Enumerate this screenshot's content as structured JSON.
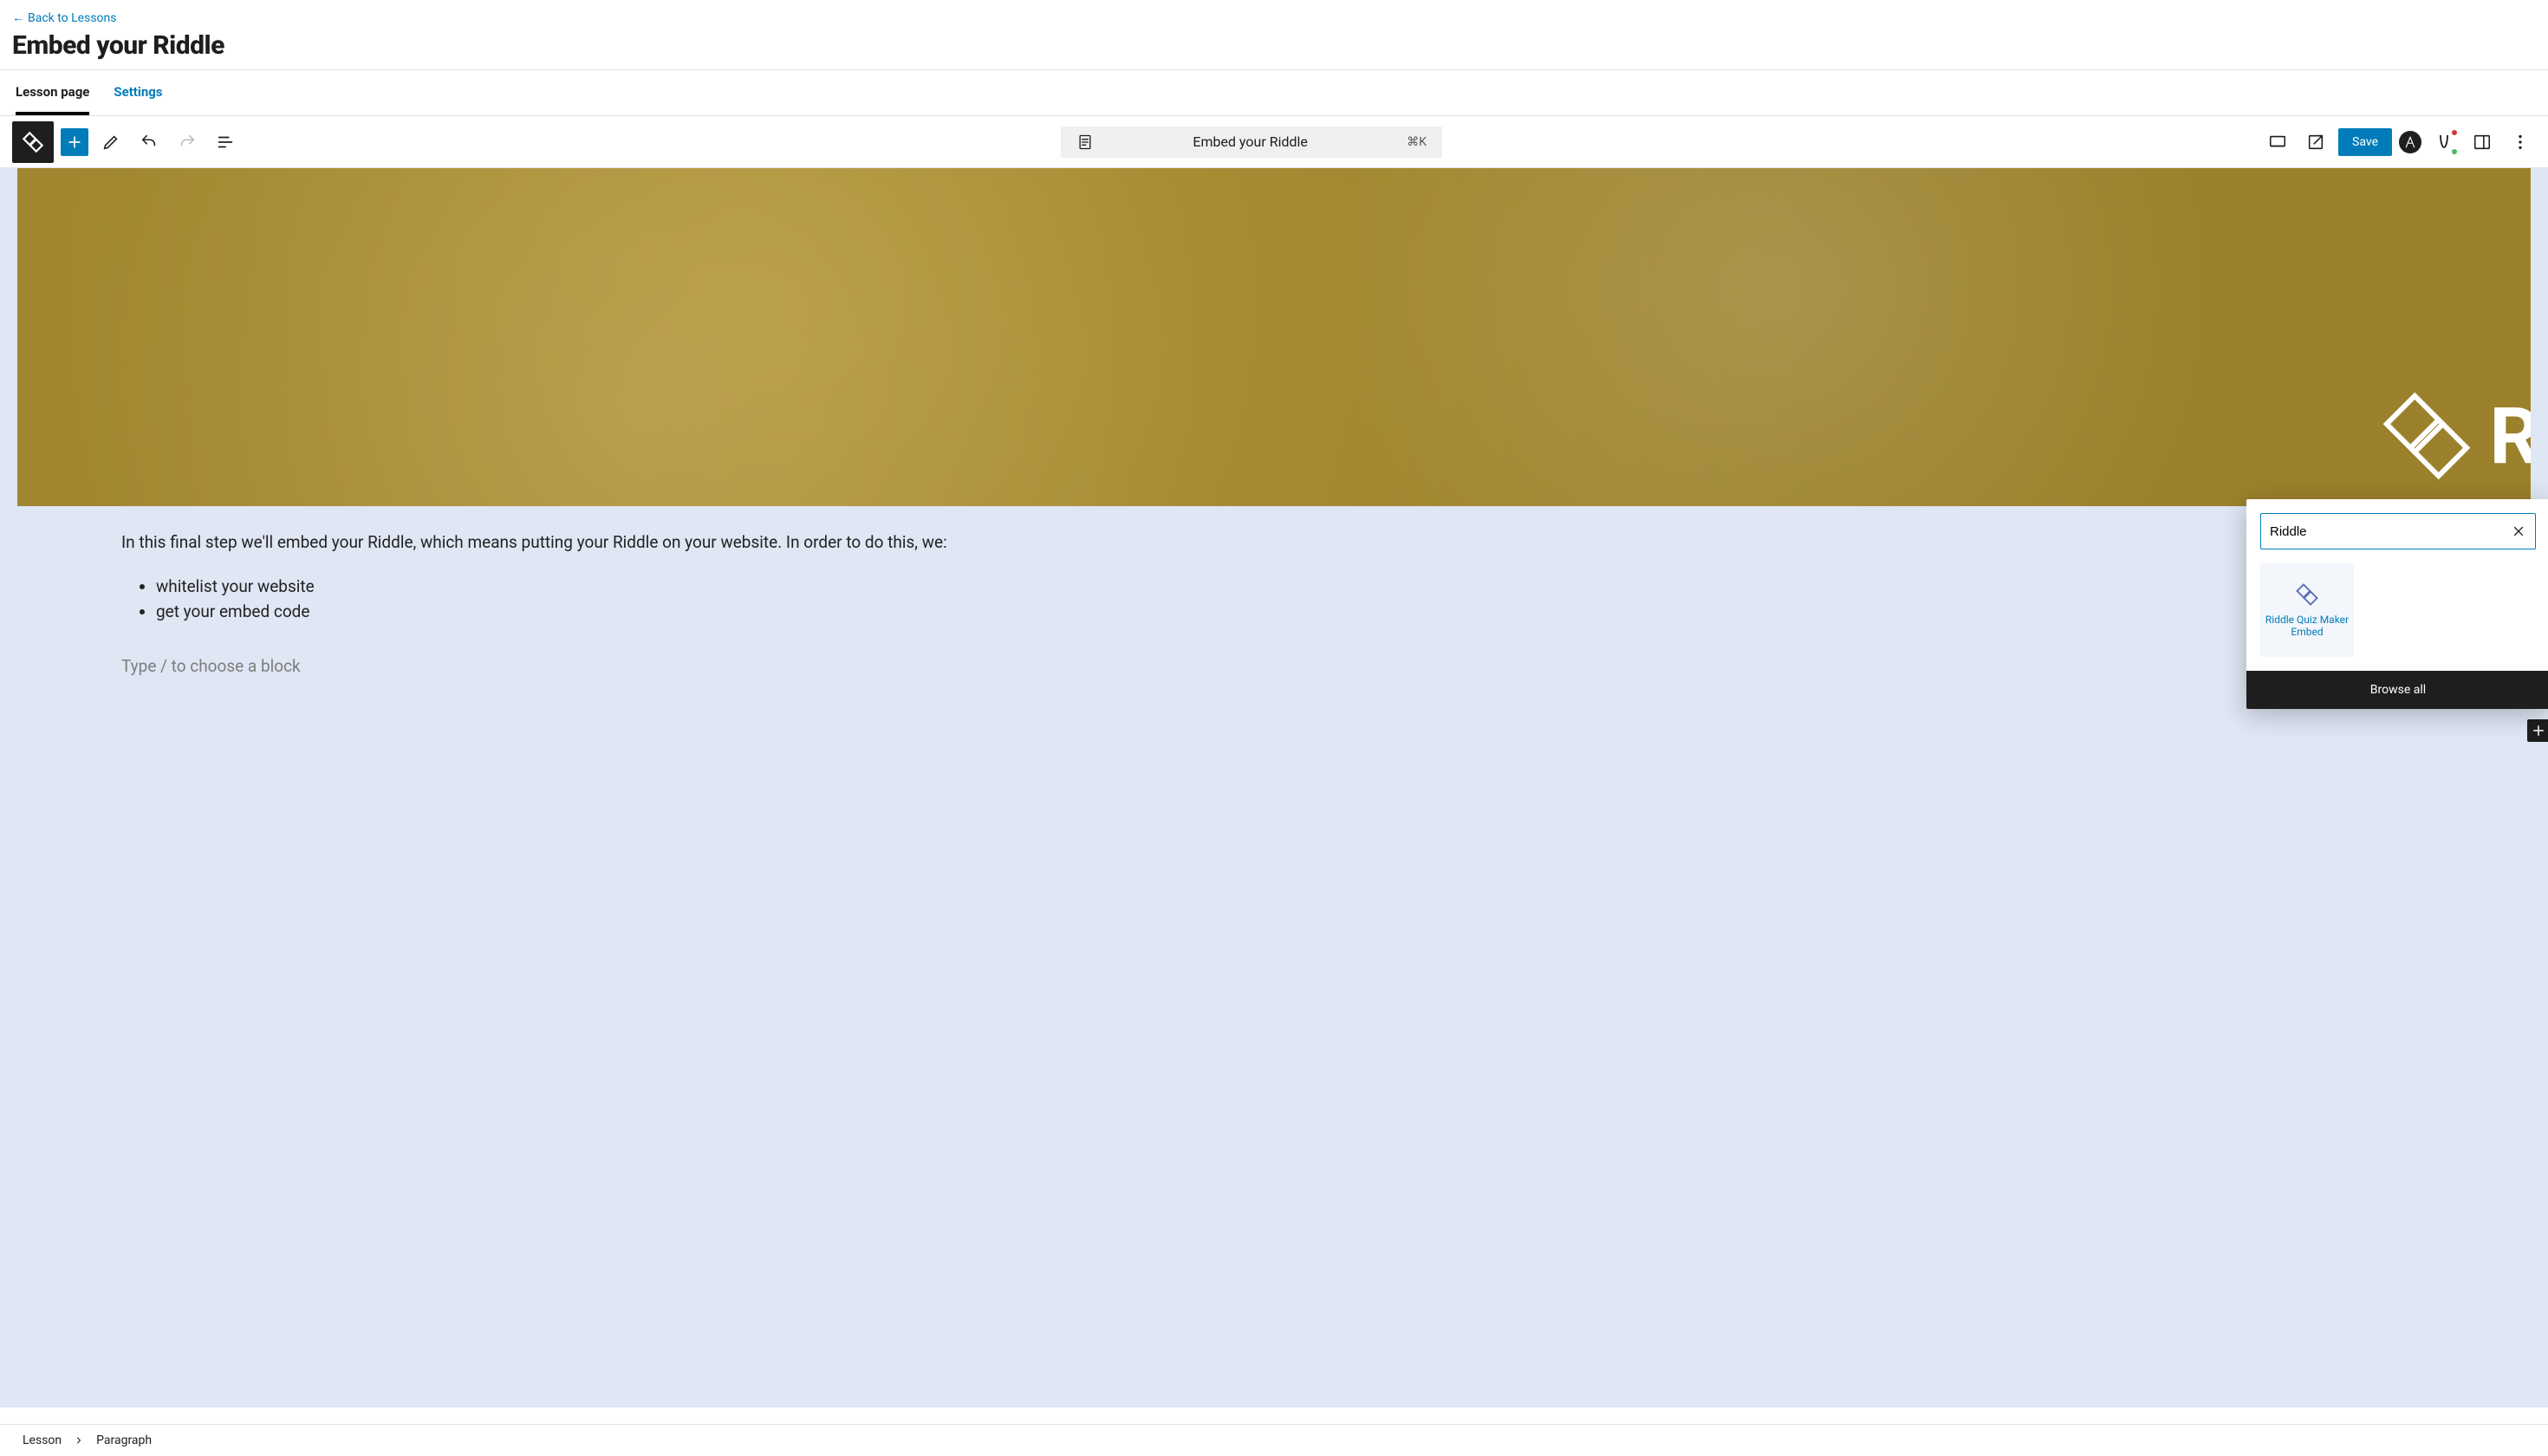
{
  "header": {
    "back_label": "Back to Lessons",
    "title": "Embed your Riddle"
  },
  "tabs": {
    "lesson_page": "Lesson page",
    "settings": "Settings"
  },
  "toolbar": {
    "doc_title": "Embed your Riddle",
    "shortcut": "⌘K",
    "save_label": "Save"
  },
  "hero": {
    "brand_text": "Ri"
  },
  "content": {
    "intro": "In this final step we'll embed your Riddle, which means putting your Riddle on your website. In order to do this, we:",
    "bullets": [
      "whitelist your website",
      "get your embed code"
    ],
    "placeholder": "Type / to choose a block"
  },
  "inserter": {
    "search_value": "Riddle",
    "result_1_label": "Riddle Quiz Maker Embed",
    "browse_all_label": "Browse all"
  },
  "breadcrumb": {
    "item1": "Lesson",
    "item2": "Paragraph"
  }
}
